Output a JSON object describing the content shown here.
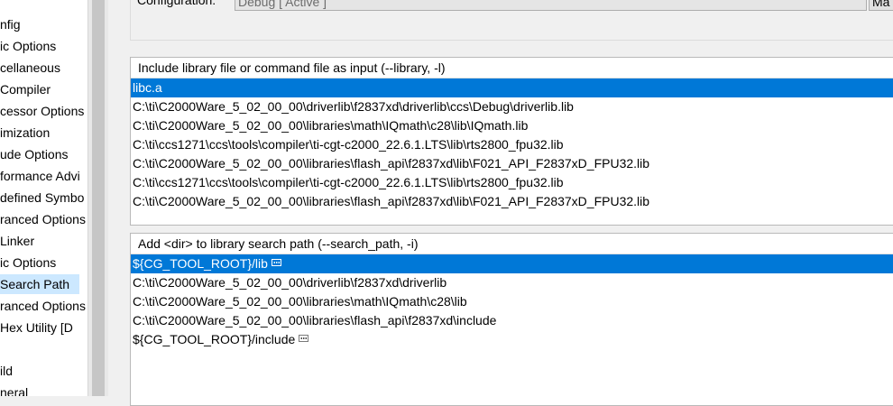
{
  "tree": {
    "items": [
      {
        "label": "nfig",
        "selected": false
      },
      {
        "label": "ic Options",
        "selected": false
      },
      {
        "label": "cellaneous",
        "selected": false
      },
      {
        "label": " Compiler",
        "selected": false
      },
      {
        "label": "cessor Options",
        "selected": false
      },
      {
        "label": "imization",
        "selected": false
      },
      {
        "label": "ude Options",
        "selected": false
      },
      {
        "label": "formance Advi",
        "selected": false
      },
      {
        "label": "defined Symbo",
        "selected": false
      },
      {
        "label": "ranced Options",
        "selected": false
      },
      {
        "label": " Linker",
        "selected": false
      },
      {
        "label": "ic Options",
        "selected": false
      },
      {
        "label": " Search Path",
        "selected": true
      },
      {
        "label": "ranced Options",
        "selected": false
      },
      {
        "label": " Hex Utility  [D",
        "selected": false
      },
      {
        "label": "",
        "selected": false
      },
      {
        "label": "ild",
        "selected": false
      },
      {
        "label": "neral",
        "selected": false
      }
    ]
  },
  "config": {
    "label": "Configuration:",
    "value": "Debug  [ Active ]",
    "manage_label": "Ma"
  },
  "library_list": {
    "header": "Include library file or command file as input (--library, -l)",
    "rows": [
      {
        "text": "libc.a",
        "selected": true,
        "has_var_icon": false
      },
      {
        "text": "C:\\ti\\C2000Ware_5_02_00_00\\driverlib\\f2837xd\\driverlib\\ccs\\Debug\\driverlib.lib",
        "selected": false,
        "has_var_icon": false
      },
      {
        "text": "C:\\ti\\C2000Ware_5_02_00_00\\libraries\\math\\IQmath\\c28\\lib\\IQmath.lib",
        "selected": false,
        "has_var_icon": false
      },
      {
        "text": "C:\\ti\\ccs1271\\ccs\\tools\\compiler\\ti-cgt-c2000_22.6.1.LTS\\lib\\rts2800_fpu32.lib",
        "selected": false,
        "has_var_icon": false
      },
      {
        "text": "C:\\ti\\C2000Ware_5_02_00_00\\libraries\\flash_api\\f2837xd\\lib\\F021_API_F2837xD_FPU32.lib",
        "selected": false,
        "has_var_icon": false
      },
      {
        "text": "C:\\ti\\ccs1271\\ccs\\tools\\compiler\\ti-cgt-c2000_22.6.1.LTS\\lib\\rts2800_fpu32.lib",
        "selected": false,
        "has_var_icon": false
      },
      {
        "text": "C:\\ti\\C2000Ware_5_02_00_00\\libraries\\flash_api\\f2837xd\\lib\\F021_API_F2837xD_FPU32.lib",
        "selected": false,
        "has_var_icon": false
      }
    ]
  },
  "search_path_list": {
    "header": "Add <dir> to library search path (--search_path, -i)",
    "rows": [
      {
        "text": "${CG_TOOL_ROOT}/lib",
        "selected": true,
        "has_var_icon": true
      },
      {
        "text": "C:\\ti\\C2000Ware_5_02_00_00\\driverlib\\f2837xd\\driverlib",
        "selected": false,
        "has_var_icon": false
      },
      {
        "text": "C:\\ti\\C2000Ware_5_02_00_00\\libraries\\math\\IQmath\\c28\\lib",
        "selected": false,
        "has_var_icon": false
      },
      {
        "text": "C:\\ti\\C2000Ware_5_02_00_00\\libraries\\flash_api\\f2837xd\\include",
        "selected": false,
        "has_var_icon": false
      },
      {
        "text": "${CG_TOOL_ROOT}/include",
        "selected": false,
        "has_var_icon": true
      }
    ]
  },
  "colors": {
    "selection": "#0078d7",
    "tree_selection": "#cce8ff"
  }
}
